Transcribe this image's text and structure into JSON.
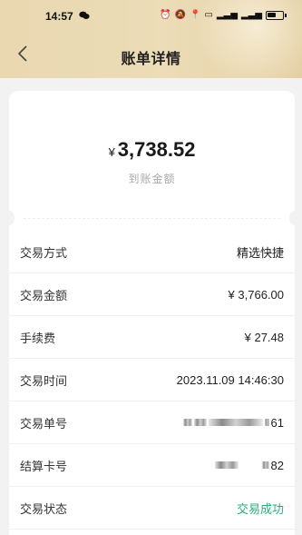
{
  "status_bar": {
    "time": "14:57"
  },
  "nav": {
    "title": "账单详情"
  },
  "summary": {
    "currency": "¥",
    "amount": "3,738.52",
    "label": "到账金额"
  },
  "details": [
    {
      "label": "交易方式",
      "value": "精选快捷"
    },
    {
      "label": "交易金额",
      "value": "¥ 3,766.00"
    },
    {
      "label": "手续费",
      "value": "¥ 27.48"
    },
    {
      "label": "交易时间",
      "value": "2023.11.09 14:46:30"
    },
    {
      "label": "交易单号",
      "value": "61"
    },
    {
      "label": "结算卡号",
      "value": "82"
    },
    {
      "label": "交易状态",
      "value": "交易成功"
    }
  ],
  "colors": {
    "success": "#25b07a",
    "header_gold": "#e9d8b0"
  }
}
